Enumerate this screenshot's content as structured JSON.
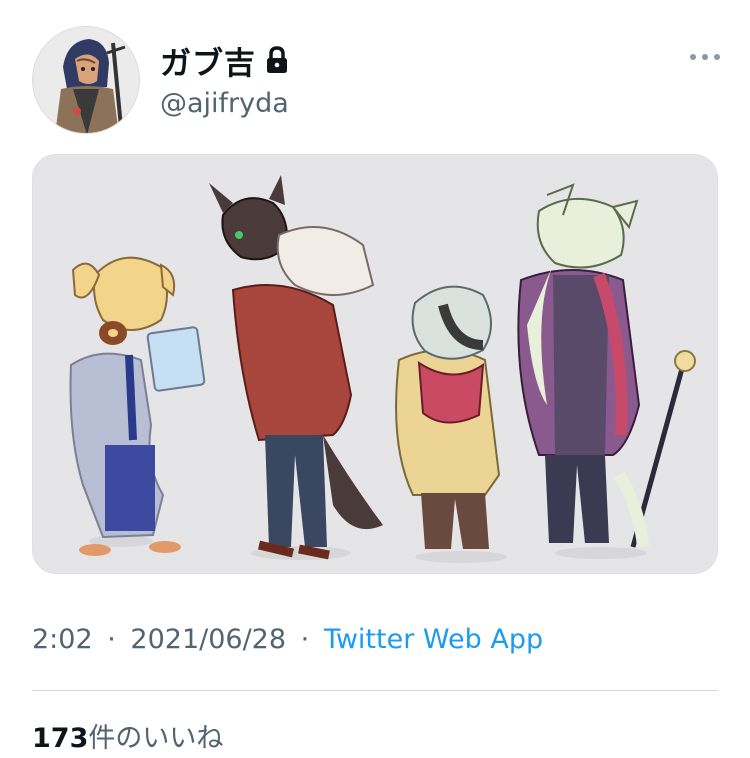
{
  "author": {
    "display_name": "ガブ吉",
    "handle": "@ajifryda",
    "protected_icon": "lock-icon",
    "avatar_alt": "avatar-illustration"
  },
  "menu": {
    "more_icon": "more-horizontal-icon"
  },
  "media": {
    "type": "illustration",
    "description_icon": "character-lineup-image"
  },
  "meta": {
    "time": "2:02",
    "separator": "·",
    "date": "2021/06/28",
    "source": "Twitter Web App"
  },
  "stats": {
    "likes_count": "173",
    "likes_label": "件のいいね"
  },
  "colors": {
    "text_primary": "#0f1419",
    "text_secondary": "#536471",
    "link": "#1d9bf0",
    "divider": "#cfd9de",
    "media_bg": "#e5e5e7"
  }
}
